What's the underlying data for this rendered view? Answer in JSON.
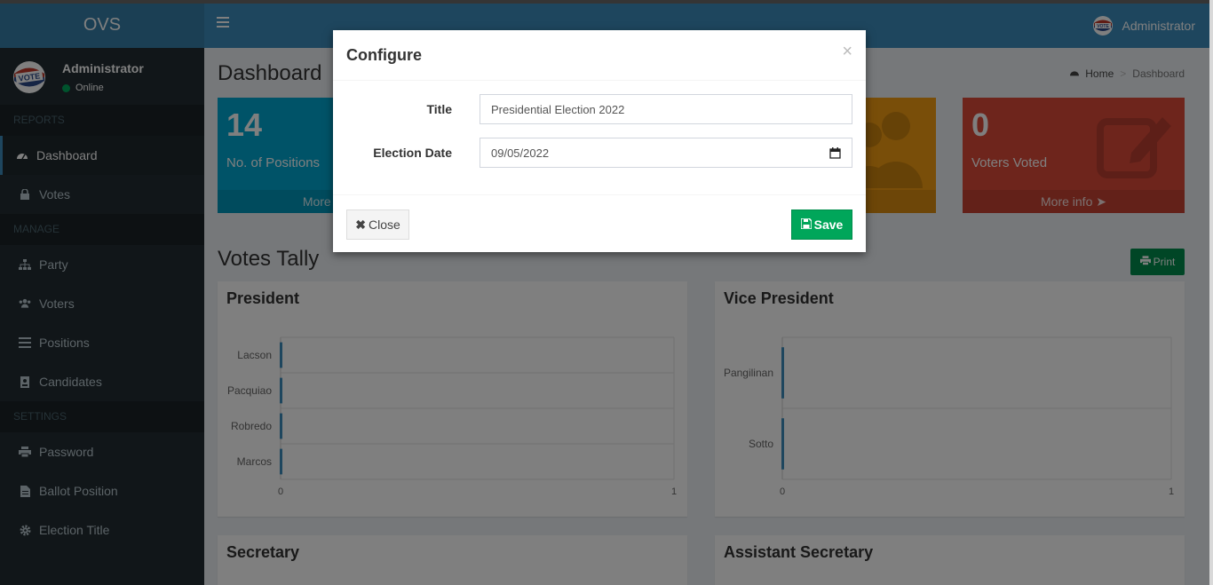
{
  "brand": "OVS",
  "navbar": {
    "user_name": "Administrator"
  },
  "sidebar": {
    "user_name": "Administrator",
    "status": "Online",
    "sections": {
      "reports": "REPORTS",
      "manage": "MANAGE",
      "settings": "SETTINGS"
    },
    "items": {
      "dashboard": "Dashboard",
      "votes": "Votes",
      "party": "Party",
      "voters": "Voters",
      "positions": "Positions",
      "candidates": "Candidates",
      "password": "Password",
      "ballot_position": "Ballot Position",
      "election_title": "Election Title"
    }
  },
  "page": {
    "title": "Dashboard",
    "breadcrumb_home": "Home",
    "breadcrumb_current": "Dashboard"
  },
  "stats": {
    "positions": {
      "value": "14",
      "label": "No. of Positions",
      "footer": "More info"
    },
    "voters_voted": {
      "value": "0",
      "label": "Voters Voted",
      "footer": "More info"
    }
  },
  "tally": {
    "title": "Votes Tally",
    "print_label": "Print",
    "boxes": {
      "president": "President",
      "vice_president": "Vice President",
      "secretary": "Secretary",
      "assistant_secretary": "Assistant Secretary"
    }
  },
  "chart_data": [
    {
      "type": "bar",
      "orientation": "horizontal",
      "title": "President",
      "categories": [
        "Lacson",
        "Pacquiao",
        "Robredo",
        "Marcos"
      ],
      "values": [
        0,
        0,
        0,
        0
      ],
      "xlim": [
        0,
        1
      ],
      "x_ticks": [
        "0",
        "1"
      ],
      "color": "#3c8dbc"
    },
    {
      "type": "bar",
      "orientation": "horizontal",
      "title": "Vice President",
      "categories": [
        "Pangilinan",
        "Sotto"
      ],
      "values": [
        0,
        0
      ],
      "xlim": [
        0,
        1
      ],
      "x_ticks": [
        "0",
        "1"
      ],
      "color": "#3c8dbc"
    }
  ],
  "modal": {
    "title": "Configure",
    "close_x": "×",
    "fields": {
      "title_label": "Title",
      "title_value": "Presidential Election 2022",
      "date_label": "Election Date",
      "date_value": "09/05/2022"
    },
    "buttons": {
      "close": "Close",
      "save": "Save"
    }
  },
  "colors": {
    "primary": "#3c8dbc",
    "sidebar": "#222d32",
    "aqua": "#00a7d0",
    "yellow": "#f39c12",
    "red": "#dd4b39",
    "success": "#00a65a"
  }
}
